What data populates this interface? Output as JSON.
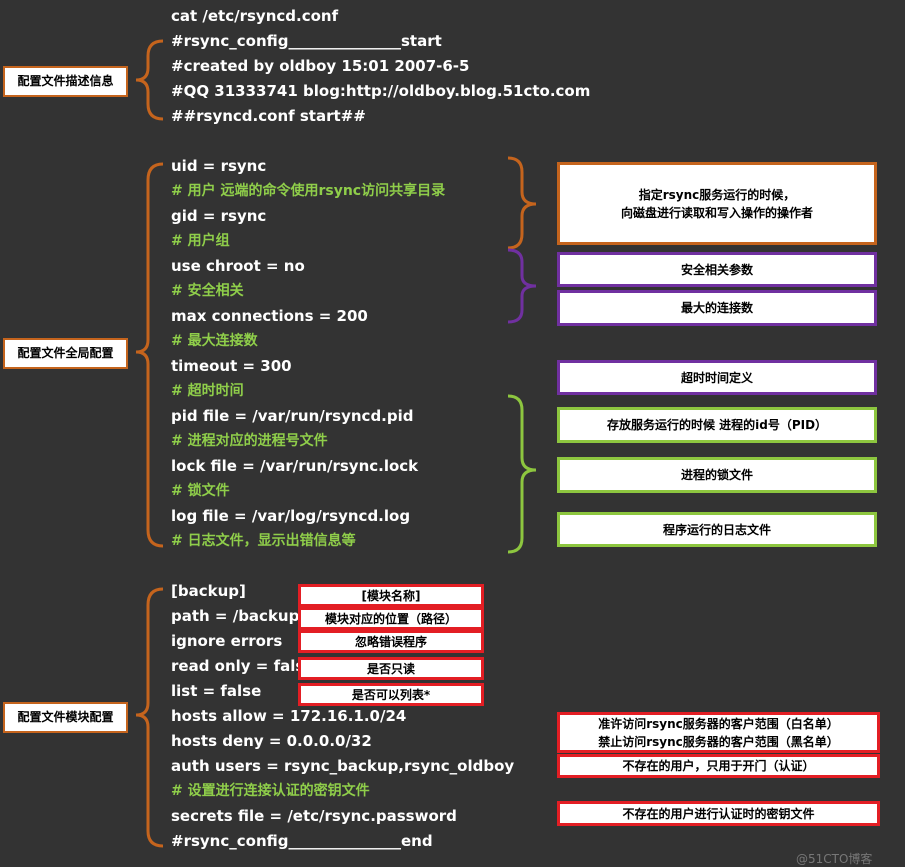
{
  "colors": {
    "background": "#333333",
    "text": "#ffffff",
    "comment": "#8fce4a",
    "orange": "#c5641d",
    "purple": "#7030a0",
    "green": "#8dc63f",
    "red": "#e31e24"
  },
  "code_lines": [
    {
      "text": "cat /etc/rsyncd.conf",
      "kind": "code"
    },
    {
      "text": "#rsync_config_______________start",
      "kind": "code"
    },
    {
      "text": "#created by oldboy 15:01 2007-6-5",
      "kind": "code"
    },
    {
      "text": "#QQ 31333741 blog:http://oldboy.blog.51cto.com",
      "kind": "code"
    },
    {
      "text": "##rsyncd.conf start##",
      "kind": "code"
    },
    {
      "text": "",
      "kind": "blank"
    },
    {
      "text": "uid = rsync",
      "kind": "code"
    },
    {
      "text": "# 用户 远端的命令使用rsync访问共享目录",
      "kind": "comment"
    },
    {
      "text": "gid = rsync",
      "kind": "code"
    },
    {
      "text": "# 用户组",
      "kind": "comment"
    },
    {
      "text": "use chroot = no",
      "kind": "code"
    },
    {
      "text": "# 安全相关",
      "kind": "comment"
    },
    {
      "text": "max connections = 200",
      "kind": "code"
    },
    {
      "text": "# 最大连接数",
      "kind": "comment"
    },
    {
      "text": "timeout = 300",
      "kind": "code"
    },
    {
      "text": "# 超时时间",
      "kind": "comment"
    },
    {
      "text": "pid file = /var/run/rsyncd.pid",
      "kind": "code"
    },
    {
      "text": "# 进程对应的进程号文件",
      "kind": "comment"
    },
    {
      "text": "lock file = /var/run/rsync.lock",
      "kind": "code"
    },
    {
      "text": "# 锁文件",
      "kind": "comment"
    },
    {
      "text": "log file = /var/log/rsyncd.log",
      "kind": "code"
    },
    {
      "text": "# 日志文件，显示出错信息等",
      "kind": "comment"
    },
    {
      "text": "",
      "kind": "blank"
    },
    {
      "text": "[backup]",
      "kind": "code"
    },
    {
      "text": "path = /backup",
      "kind": "code"
    },
    {
      "text": "ignore errors",
      "kind": "code"
    },
    {
      "text": "read only = false",
      "kind": "code"
    },
    {
      "text": "list = false",
      "kind": "code"
    },
    {
      "text": "hosts allow = 172.16.1.0/24",
      "kind": "code"
    },
    {
      "text": "hosts deny = 0.0.0.0/32",
      "kind": "code"
    },
    {
      "text": "auth users = rsync_backup,rsync_oldboy",
      "kind": "code"
    },
    {
      "text": "# 设置进行连接认证的密钥文件",
      "kind": "comment"
    },
    {
      "text": "secrets file = /etc/rsync.password",
      "kind": "code"
    },
    {
      "text": "#rsync_config_______________end",
      "kind": "code"
    }
  ],
  "sections": {
    "description": "配置文件描述信息",
    "global": "配置文件全局配置",
    "module": "配置文件模块配置"
  },
  "notes": {
    "user_line1": "指定rsync服务运行的时候，",
    "user_line2": "向磁盘进行读取和写入操作的操作者",
    "security": "安全相关参数",
    "max_conn": "最大的连接数",
    "timeout": "超时时间定义",
    "pid": "存放服务运行的时候 进程的id号（PID）",
    "lock": "进程的锁文件",
    "log": "程序运行的日志文件",
    "module_name": "[模块名称]",
    "module_path": "模块对应的位置（路径）",
    "ignore": "忽略错误程序",
    "readonly": "是否只读",
    "list": "是否可以列表*",
    "hosts_allow": "准许访问rsync服务器的客户范围（白名单）",
    "hosts_deny": "禁止访问rsync服务器的客户范围（黑名单）",
    "auth": "不存在的用户，只用于开门（认证）",
    "secrets": "不存在的用户进行认证时的密钥文件"
  },
  "watermark": "@51CTO博客"
}
